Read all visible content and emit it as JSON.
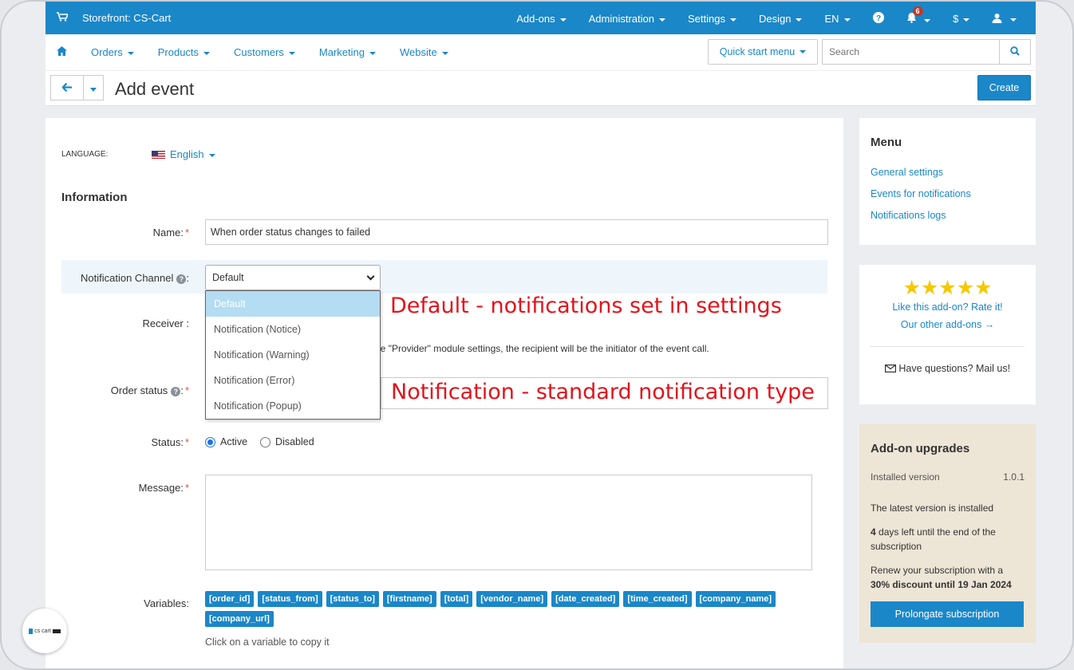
{
  "topbar": {
    "store_label": "Storefront: CS-Cart",
    "menu": [
      "Add-ons",
      "Administration",
      "Settings",
      "Design",
      "EN"
    ],
    "notification_count": "6",
    "currency": "$"
  },
  "nav": {
    "items": [
      "Orders",
      "Products",
      "Customers",
      "Marketing",
      "Website"
    ],
    "quick_start": "Quick start menu",
    "search_placeholder": "Search"
  },
  "title": {
    "text": "Add event",
    "create_label": "Create"
  },
  "form": {
    "language_label": "LANGUAGE:",
    "language_value": "English",
    "section": "Information",
    "name_label": "Name:",
    "name_value": "When order status changes to failed",
    "channel_label": "Notification Channel",
    "channel_value": "Default",
    "channel_options": [
      "Default",
      "Notification (Notice)",
      "Notification (Warning)",
      "Notification (Error)",
      "Notification (Popup)"
    ],
    "receiver_label": "Receiver :",
    "receiver_note": "in the \"Provider\" module settings, the recipient will be the initiator of the event call.",
    "order_status_label": "Order status",
    "status_label": "Status:",
    "status_active": "Active",
    "status_disabled": "Disabled",
    "message_label": "Message:",
    "variables_label": "Variables:",
    "variables": [
      "[order_id]",
      "[status_from]",
      "[status_to]",
      "[firstname]",
      "[total]",
      "[vendor_name]",
      "[date_created]",
      "[time_created]",
      "[company_name]",
      "[company_url]"
    ],
    "copy_note": "Click on a variable to copy it"
  },
  "annotations": {
    "default_note": "Default - notifications set in settings",
    "notification_note": "Notification - standard notification type"
  },
  "sidebar": {
    "menu_title": "Menu",
    "menu_links": [
      "General settings",
      "Events for notifications",
      "Notifications logs"
    ],
    "rate_text": "Like this add-on? Rate it!",
    "other_addons": "Our other add-ons →",
    "mail_us": "Have questions? Mail us!",
    "upgrades_title": "Add-on upgrades",
    "installed_label": "Installed version",
    "installed_value": "1.0.1",
    "latest_text": "The latest version is installed",
    "days_num": "4",
    "days_text": " days left until the end of the subscription",
    "renew_text": "Renew your subscription with a",
    "discount_text": "30% discount until 19 Jan 2024",
    "prolong_label": "Prolongate subscription"
  },
  "logo_text": "cs cart"
}
